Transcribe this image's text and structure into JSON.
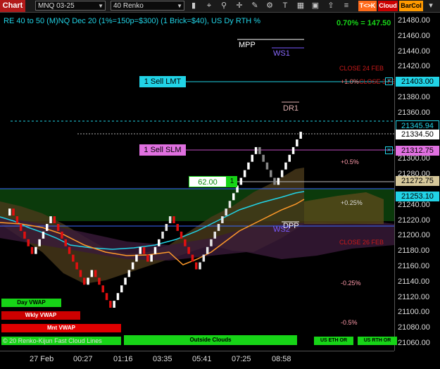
{
  "toolbar": {
    "chart_label": "Chart",
    "instrument": "MNQ 03-25",
    "period": "40 Renko",
    "tag_tck": "T<>K",
    "tag_cloud": "Cloud",
    "tag_barcol": "BarCol",
    "colors": {
      "tck": "#ff6a1a",
      "cloud": "#cc0000",
      "barcol": "#ff9900"
    }
  },
  "chart": {
    "header": "RE 40 to 50 (M)NQ Dec 20 (1%=150p=$300) (1 Brick=$40), US Dy RTH %",
    "pct_readout": "0.70% = 147.50",
    "labels": {
      "mpp": "MPP",
      "ws1": "WS1",
      "dr1": "DR1",
      "dpp": "DPP",
      "ws2": "WS2",
      "close24": "CLOSE 24 FEB",
      "pct1": "+1.0%",
      "close3": "CLOSE 3 FEB",
      "pct05": "+0.5%",
      "pct025": "+0.25%",
      "close26": "CLOSE 26 FEB",
      "neg025": "-0.25%",
      "neg05": "-0.5%"
    },
    "orders": {
      "sell_lmt": "1 Sell LMT",
      "sell_slm": "1 Sell SLM",
      "position_price": "62.00",
      "position_qty": "1"
    },
    "buttons": {
      "day_vwap": "Day VWAP",
      "wkly_vwap": "Wkly VWAP",
      "mnt_vwap": "Mnt VWAP",
      "outside_clouds": "Outside Clouds",
      "us_eth_or": "US ETH OR",
      "us_rth_or": "US RTH OR"
    },
    "copyright": "© 20 Renko-Kijun Fast Cloud Lines"
  },
  "price_axis": {
    "ticks": [
      "21480.00",
      "21460.00",
      "21440.00",
      "21420.00",
      "21400.00",
      "21380.00",
      "21360.00",
      "21345.94",
      "21334.50",
      "21312.75",
      "21300.00",
      "21280.00",
      "21272.75",
      "21253.10",
      "21240.00",
      "21220.00",
      "21200.00",
      "21180.00",
      "21160.00",
      "21140.00",
      "21120.00",
      "21100.00",
      "21080.00",
      "21060.00"
    ],
    "highlight": {
      "p21403": "21403.00",
      "p21345": "21345.94",
      "p21334": "21334.50",
      "p21312": "21312.75",
      "p21272": "21272.75",
      "p21253": "21253.10"
    }
  },
  "time_axis": [
    "27 Feb",
    "00:27",
    "01:16",
    "03:35",
    "05:41",
    "07:25",
    "08:58"
  ],
  "chart_data": {
    "type": "line",
    "ylim": [
      21050,
      21490
    ],
    "brick_closes": [
      21235,
      21225,
      21215,
      21205,
      21195,
      21185,
      21175,
      21185,
      21195,
      21205,
      21215,
      21225,
      21215,
      21205,
      21195,
      21185,
      21175,
      21165,
      21155,
      21145,
      21135,
      21145,
      21155,
      21145,
      21135,
      21125,
      21115,
      21105,
      21115,
      21125,
      21135,
      21145,
      21155,
      21165,
      21175,
      21185,
      21175,
      21165,
      21175,
      21185,
      21195,
      21205,
      21215,
      21225,
      21215,
      21205,
      21195,
      21185,
      21175,
      21165,
      21155,
      21165,
      21175,
      21185,
      21195,
      21205,
      21215,
      21225,
      21235,
      21245,
      21255,
      21265,
      21275,
      21285,
      21295,
      21305,
      21315,
      21305,
      21295,
      21285,
      21275,
      21265,
      21275,
      21285,
      21295,
      21305,
      21315,
      21325,
      21335
    ]
  }
}
